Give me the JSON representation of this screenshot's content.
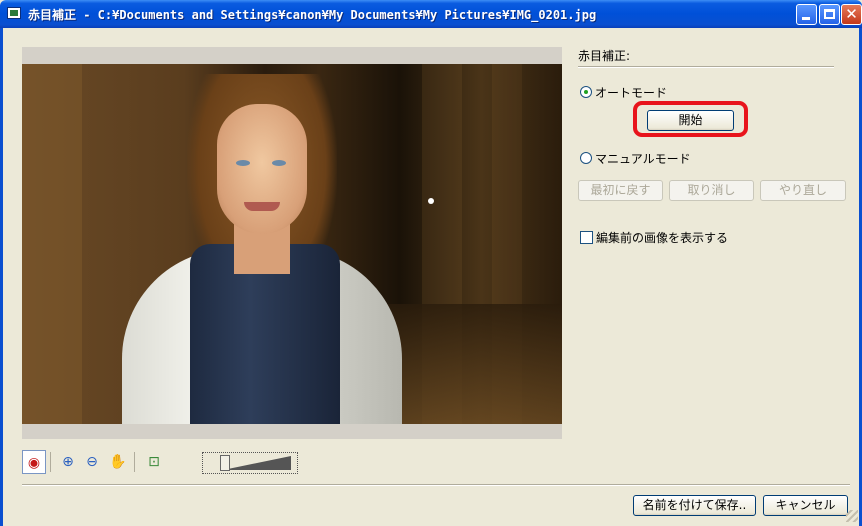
{
  "window": {
    "title": "赤目補正 - C:¥Documents and Settings¥canon¥My Documents¥My Pictures¥IMG_0201.jpg",
    "buttons": {
      "close_glyph": "✕"
    }
  },
  "panel": {
    "section_label": "赤目補正:",
    "auto_mode": {
      "label": "オートモード",
      "selected": true
    },
    "start_button": "開始",
    "manual_mode": {
      "label": "マニュアルモード",
      "selected": false
    },
    "manual_buttons": {
      "reset": "最初に戻す",
      "undo": "取り消し",
      "redo": "やり直し"
    },
    "show_before": {
      "label": "編集前の画像を表示する",
      "checked": false
    }
  },
  "toolbar": {
    "icons": [
      "red-eye-icon",
      "zoom-in-icon",
      "zoom-out-icon",
      "hand-icon",
      "fit-window-icon"
    ],
    "glyphs": {
      "redeye": "◉",
      "zoom_in": "⊕",
      "zoom_out": "⊖",
      "hand": "✋",
      "fit": "⊡"
    },
    "zoom_level": 0.1
  },
  "footer": {
    "save_as": "名前を付けて保存..",
    "cancel": "キャンセル"
  },
  "colors": {
    "title_bar": "#0050d8",
    "highlight": "#e8141c",
    "dialog_bg": "#ece9d8"
  }
}
